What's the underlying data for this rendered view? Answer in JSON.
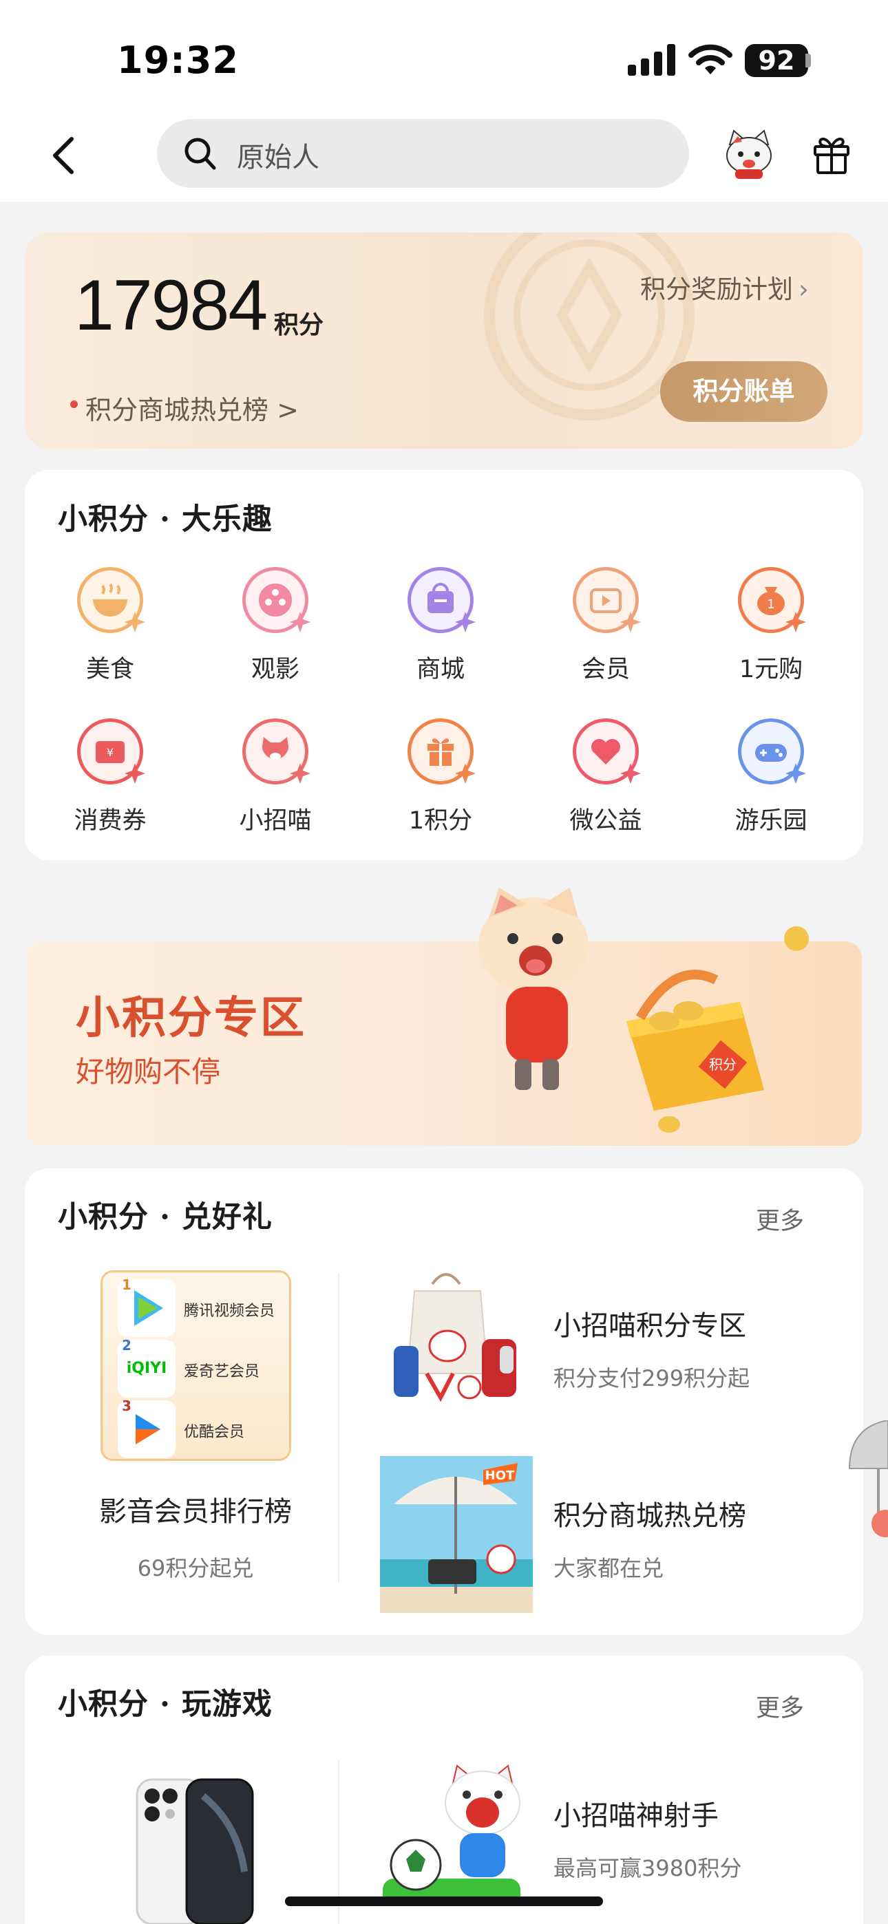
{
  "status_bar": {
    "time": "19:32",
    "battery": "92"
  },
  "header": {
    "search_text": "原始人"
  },
  "points_card": {
    "points": "17984",
    "unit": "积分",
    "reward_plan": "积分奖励计划",
    "hot_link": "积分商城热兑榜 >",
    "bill_button": "积分账单"
  },
  "fun_section": {
    "title": "小积分 · 大乐趣",
    "items": [
      {
        "label": "美食",
        "icon": "bowl-icon",
        "color": "#f3b26a"
      },
      {
        "label": "观影",
        "icon": "film-reel-icon",
        "color": "#ef8aa0"
      },
      {
        "label": "商城",
        "icon": "shopping-bag-icon",
        "color": "#a383e6"
      },
      {
        "label": "会员",
        "icon": "video-play-icon",
        "color": "#f0a27a"
      },
      {
        "label": "1元购",
        "icon": "money-bag-icon",
        "color": "#ef7d4c"
      },
      {
        "label": "消费券",
        "icon": "coupon-icon",
        "color": "#ec5b5b"
      },
      {
        "label": "小招喵",
        "icon": "cat-icon",
        "color": "#ec6b6b"
      },
      {
        "label": "1积分",
        "icon": "gift-box-icon",
        "color": "#f0844b"
      },
      {
        "label": "微公益",
        "icon": "heart-icon",
        "color": "#ee5a6a"
      },
      {
        "label": "游乐园",
        "icon": "gamepad-icon",
        "color": "#6a92ea"
      }
    ]
  },
  "banner": {
    "title": "小积分专区",
    "subtitle": "好物购不停",
    "badge": "积分"
  },
  "gift_section": {
    "title": "小积分 · 兑好礼",
    "more": "更多",
    "ranking": {
      "title": "影音会员排行榜",
      "subtitle": "69积分起兑",
      "entries": [
        {
          "rank": "1",
          "name": "腾讯视频会员",
          "logo": "tencent-video-logo-icon"
        },
        {
          "rank": "2",
          "name": "爱奇艺会员",
          "logo_text": "iQIYI"
        },
        {
          "rank": "3",
          "name": "优酷会员",
          "logo": "youku-logo-icon"
        }
      ]
    },
    "items": [
      {
        "title": "小招喵积分专区",
        "subtitle": "积分支付299积分起"
      },
      {
        "title": "积分商城热兑榜",
        "subtitle": "大家都在兑",
        "badge": "HOT"
      }
    ]
  },
  "game_section": {
    "title": "小积分 · 玩游戏",
    "more": "更多",
    "item": {
      "title": "小招喵神射手",
      "subtitle": "最高可赢3980积分"
    }
  }
}
